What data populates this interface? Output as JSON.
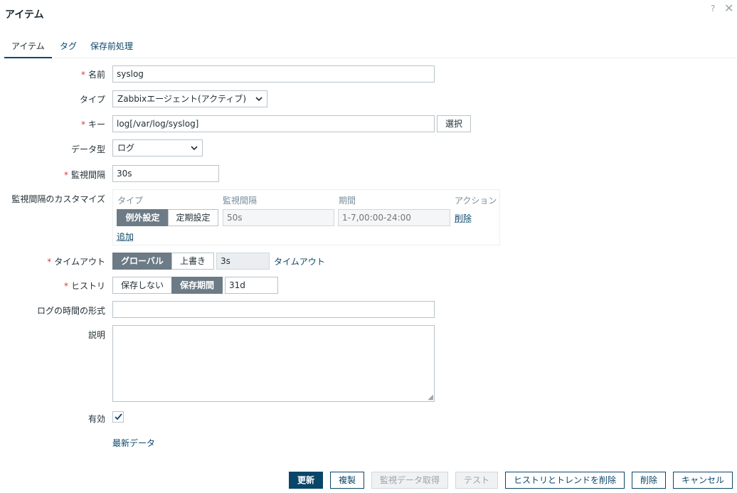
{
  "dialog": {
    "title": "アイテム",
    "help_icon": "?",
    "close_icon": "✕"
  },
  "tabs": [
    {
      "label": "アイテム",
      "active": true
    },
    {
      "label": "タグ",
      "active": false
    },
    {
      "label": "保存前処理",
      "active": false
    }
  ],
  "form": {
    "name": {
      "label": "名前",
      "value": "syslog"
    },
    "type": {
      "label": "タイプ",
      "value": "Zabbixエージェント(アクティブ)"
    },
    "key": {
      "label": "キー",
      "value": "log[/var/log/syslog]",
      "select_button": "選択"
    },
    "data_type": {
      "label": "データ型",
      "value": "ログ"
    },
    "interval": {
      "label": "監視間隔",
      "value": "30s"
    },
    "custom_intervals": {
      "label": "監視間隔のカスタマイズ",
      "headers": [
        "タイプ",
        "監視間隔",
        "期間",
        "アクション"
      ],
      "row": {
        "type_options": [
          "例外設定",
          "定期設定"
        ],
        "selected": "例外設定",
        "interval_placeholder": "50s",
        "period_placeholder": "1-7,00:00-24:00",
        "delete_label": "削除"
      },
      "add_label": "追加"
    },
    "timeout": {
      "label": "タイムアウト",
      "options": [
        "グローバル",
        "上書き"
      ],
      "selected": "グローバル",
      "value": "3s",
      "link": "タイムアウト"
    },
    "history": {
      "label": "ヒストリ",
      "options": [
        "保存しない",
        "保存期間"
      ],
      "selected": "保存期間",
      "value": "31d"
    },
    "log_time_format": {
      "label": "ログの時間の形式",
      "value": ""
    },
    "description": {
      "label": "説明",
      "value": ""
    },
    "enabled": {
      "label": "有効",
      "checked": true
    },
    "latest_data_link": "最新データ"
  },
  "footer": {
    "update": "更新",
    "clone": "複製",
    "get_value": "監視データ取得",
    "test": "テスト",
    "clear_history": "ヒストリとトレンドを削除",
    "delete": "削除",
    "cancel": "キャンセル"
  },
  "colors": {
    "primary": "#0a466a",
    "segment_selected": "#6c7b85",
    "required_mark": "#e33734"
  }
}
